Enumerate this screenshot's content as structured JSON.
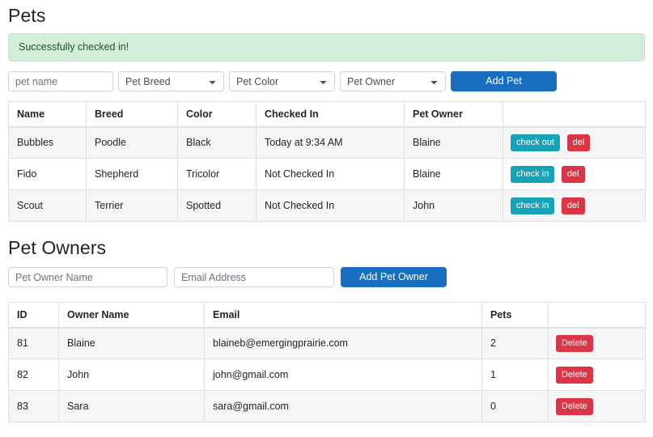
{
  "pets_section": {
    "title": "Pets",
    "alert": {
      "message": "Successfully checked in!",
      "bg_color": "#d4edda",
      "text_color": "#155724"
    },
    "form": {
      "name_placeholder": "pet name",
      "breed_selected": "Pet Breed",
      "color_selected": "Pet Color",
      "owner_selected": "Pet Owner",
      "add_button_label": "Add Pet",
      "add_button_color": "#1a6ec0"
    },
    "table": {
      "headers": [
        "Name",
        "Breed",
        "Color",
        "Checked In",
        "Pet Owner",
        ""
      ],
      "rows": [
        {
          "name": "Bubbles",
          "breed": "Poodle",
          "color": "Black",
          "checked_in": "Today at 9:34 AM",
          "owner": "Blaine",
          "action_label": "check out",
          "delete_label": "del"
        },
        {
          "name": "Fido",
          "breed": "Shepherd",
          "color": "Tricolor",
          "checked_in": "Not Checked In",
          "owner": "Blaine",
          "action_label": "check in",
          "delete_label": "del"
        },
        {
          "name": "Scout",
          "breed": "Terrier",
          "color": "Spotted",
          "checked_in": "Not Checked In",
          "owner": "John",
          "action_label": "check in",
          "delete_label": "del"
        }
      ],
      "action_button_color": "#17a2b8",
      "delete_button_color": "#dc3545"
    }
  },
  "owners_section": {
    "title": "Pet Owners",
    "form": {
      "name_placeholder": "Pet Owner Name",
      "email_placeholder": "Email Address",
      "add_button_label": "Add Pet Owner",
      "add_button_color": "#1a6ec0"
    },
    "table": {
      "headers": [
        "ID",
        "Owner Name",
        "Email",
        "Pets",
        ""
      ],
      "rows": [
        {
          "id": "81",
          "owner_name": "Blaine",
          "email": "blaineb@emergingprairie.com",
          "pets": "2",
          "delete_label": "Delete"
        },
        {
          "id": "82",
          "owner_name": "John",
          "email": "john@gmail.com",
          "pets": "1",
          "delete_label": "Delete"
        },
        {
          "id": "83",
          "owner_name": "Sara",
          "email": "sara@gmail.com",
          "pets": "0",
          "delete_label": "Delete"
        }
      ],
      "delete_button_color": "#dc3545"
    }
  }
}
